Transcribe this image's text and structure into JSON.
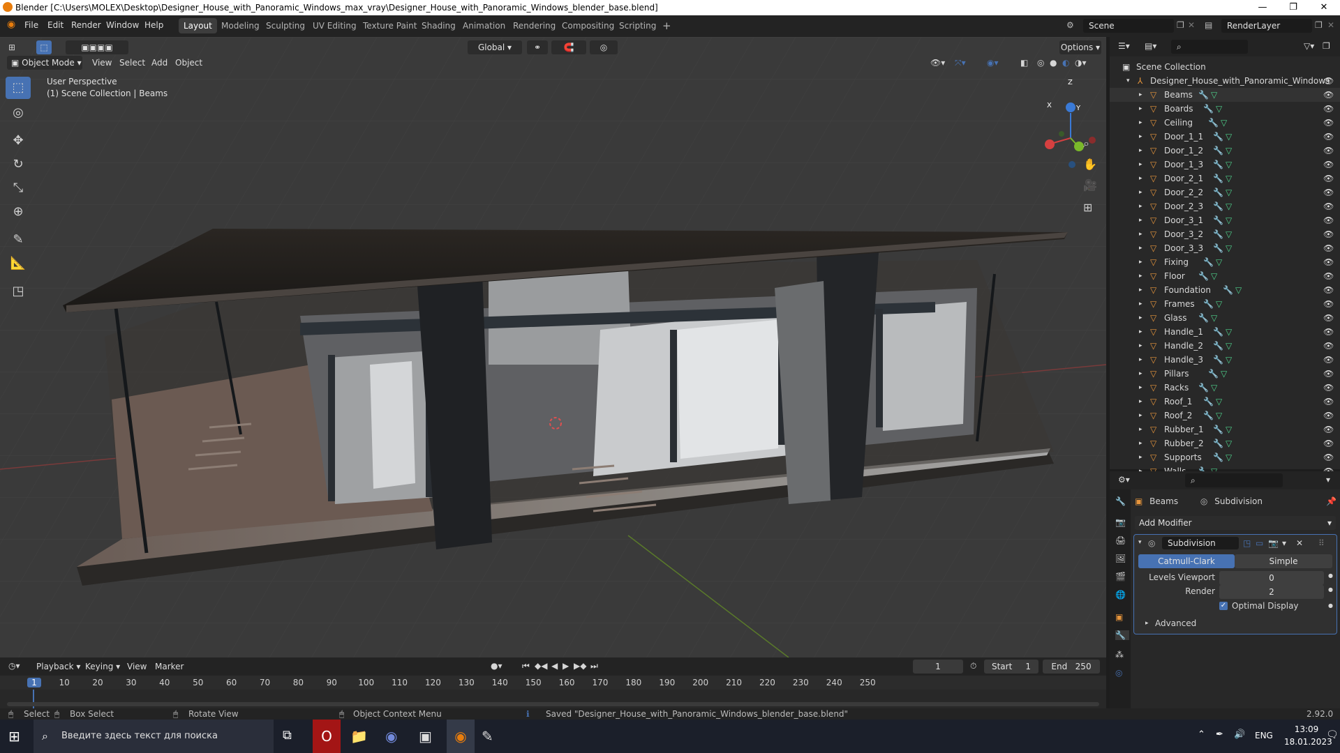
{
  "window": {
    "title": "Blender [C:\\Users\\MOLEX\\Desktop\\Designer_House_with_Panoramic_Windows_max_vray\\Designer_House_with_Panoramic_Windows_blender_base.blend]",
    "minimize": "—",
    "maximize": "❐",
    "close": "✕"
  },
  "menus": [
    "File",
    "Edit",
    "Render",
    "Window",
    "Help"
  ],
  "workspaces": [
    "Layout",
    "Modeling",
    "Sculpting",
    "UV Editing",
    "Texture Paint",
    "Shading",
    "Animation",
    "Rendering",
    "Compositing",
    "Scripting"
  ],
  "add_workspace": "+",
  "scene": {
    "name": "Scene",
    "view_layer": "RenderLayer"
  },
  "viewport": {
    "mode": "Object Mode",
    "header_menus": [
      "View",
      "Select",
      "Add",
      "Object"
    ],
    "transform_orientation": "Global",
    "options": "Options",
    "overlay_text_1": "User Perspective",
    "overlay_text_2": "(1) Scene Collection | Beams",
    "gizmo_labels": {
      "z": "Z",
      "x": "X",
      "y": "Y"
    }
  },
  "outliner": {
    "root": "Scene Collection",
    "collection": "Designer_House_with_Panoramic_Windows",
    "objects": [
      "Beams",
      "Boards",
      "Ceiling",
      "Door_1_1",
      "Door_1_2",
      "Door_1_3",
      "Door_2_1",
      "Door_2_2",
      "Door_2_3",
      "Door_3_1",
      "Door_3_2",
      "Door_3_3",
      "Fixing",
      "Floor",
      "Foundation",
      "Frames",
      "Glass",
      "Handle_1",
      "Handle_2",
      "Handle_3",
      "Pillars",
      "Racks",
      "Roof_1",
      "Roof_2",
      "Rubber_1",
      "Rubber_2",
      "Supports",
      "Walls"
    ]
  },
  "properties": {
    "object_name": "Beams",
    "modifier_breadcrumb": "Subdivision",
    "add_modifier": "Add Modifier",
    "modifier_name": "Subdivision",
    "type_a": "Catmull-Clark",
    "type_b": "Simple",
    "levels_viewport_label": "Levels Viewport",
    "levels_viewport_value": "0",
    "render_label": "Render",
    "render_value": "2",
    "optimal_display": "Optimal Display",
    "advanced": "Advanced"
  },
  "timeline": {
    "menus": [
      "Playback",
      "Keying",
      "View",
      "Marker"
    ],
    "current_frame": "1",
    "start_label": "Start",
    "start_value": "1",
    "end_label": "End",
    "end_value": "250",
    "ruler": [
      "1",
      "10",
      "20",
      "30",
      "40",
      "50",
      "60",
      "70",
      "80",
      "90",
      "100",
      "110",
      "120",
      "130",
      "140",
      "150",
      "160",
      "170",
      "180",
      "190",
      "200",
      "210",
      "220",
      "230",
      "240",
      "250"
    ]
  },
  "statusbar": {
    "select": "Select",
    "box_select": "Box Select",
    "rotate_view": "Rotate View",
    "context_menu": "Object Context Menu",
    "saved_msg": "Saved \"Designer_House_with_Panoramic_Windows_blender_base.blend\"",
    "version": "2.92.0"
  },
  "taskbar": {
    "search_placeholder": "Введите здесь текст для поиска",
    "lang": "ENG",
    "time": "13:09",
    "date": "18.01.2023"
  },
  "colors": {
    "accent": "#4772b3",
    "object_orange": "#e8963c",
    "mesh_green": "#4fd18b"
  }
}
